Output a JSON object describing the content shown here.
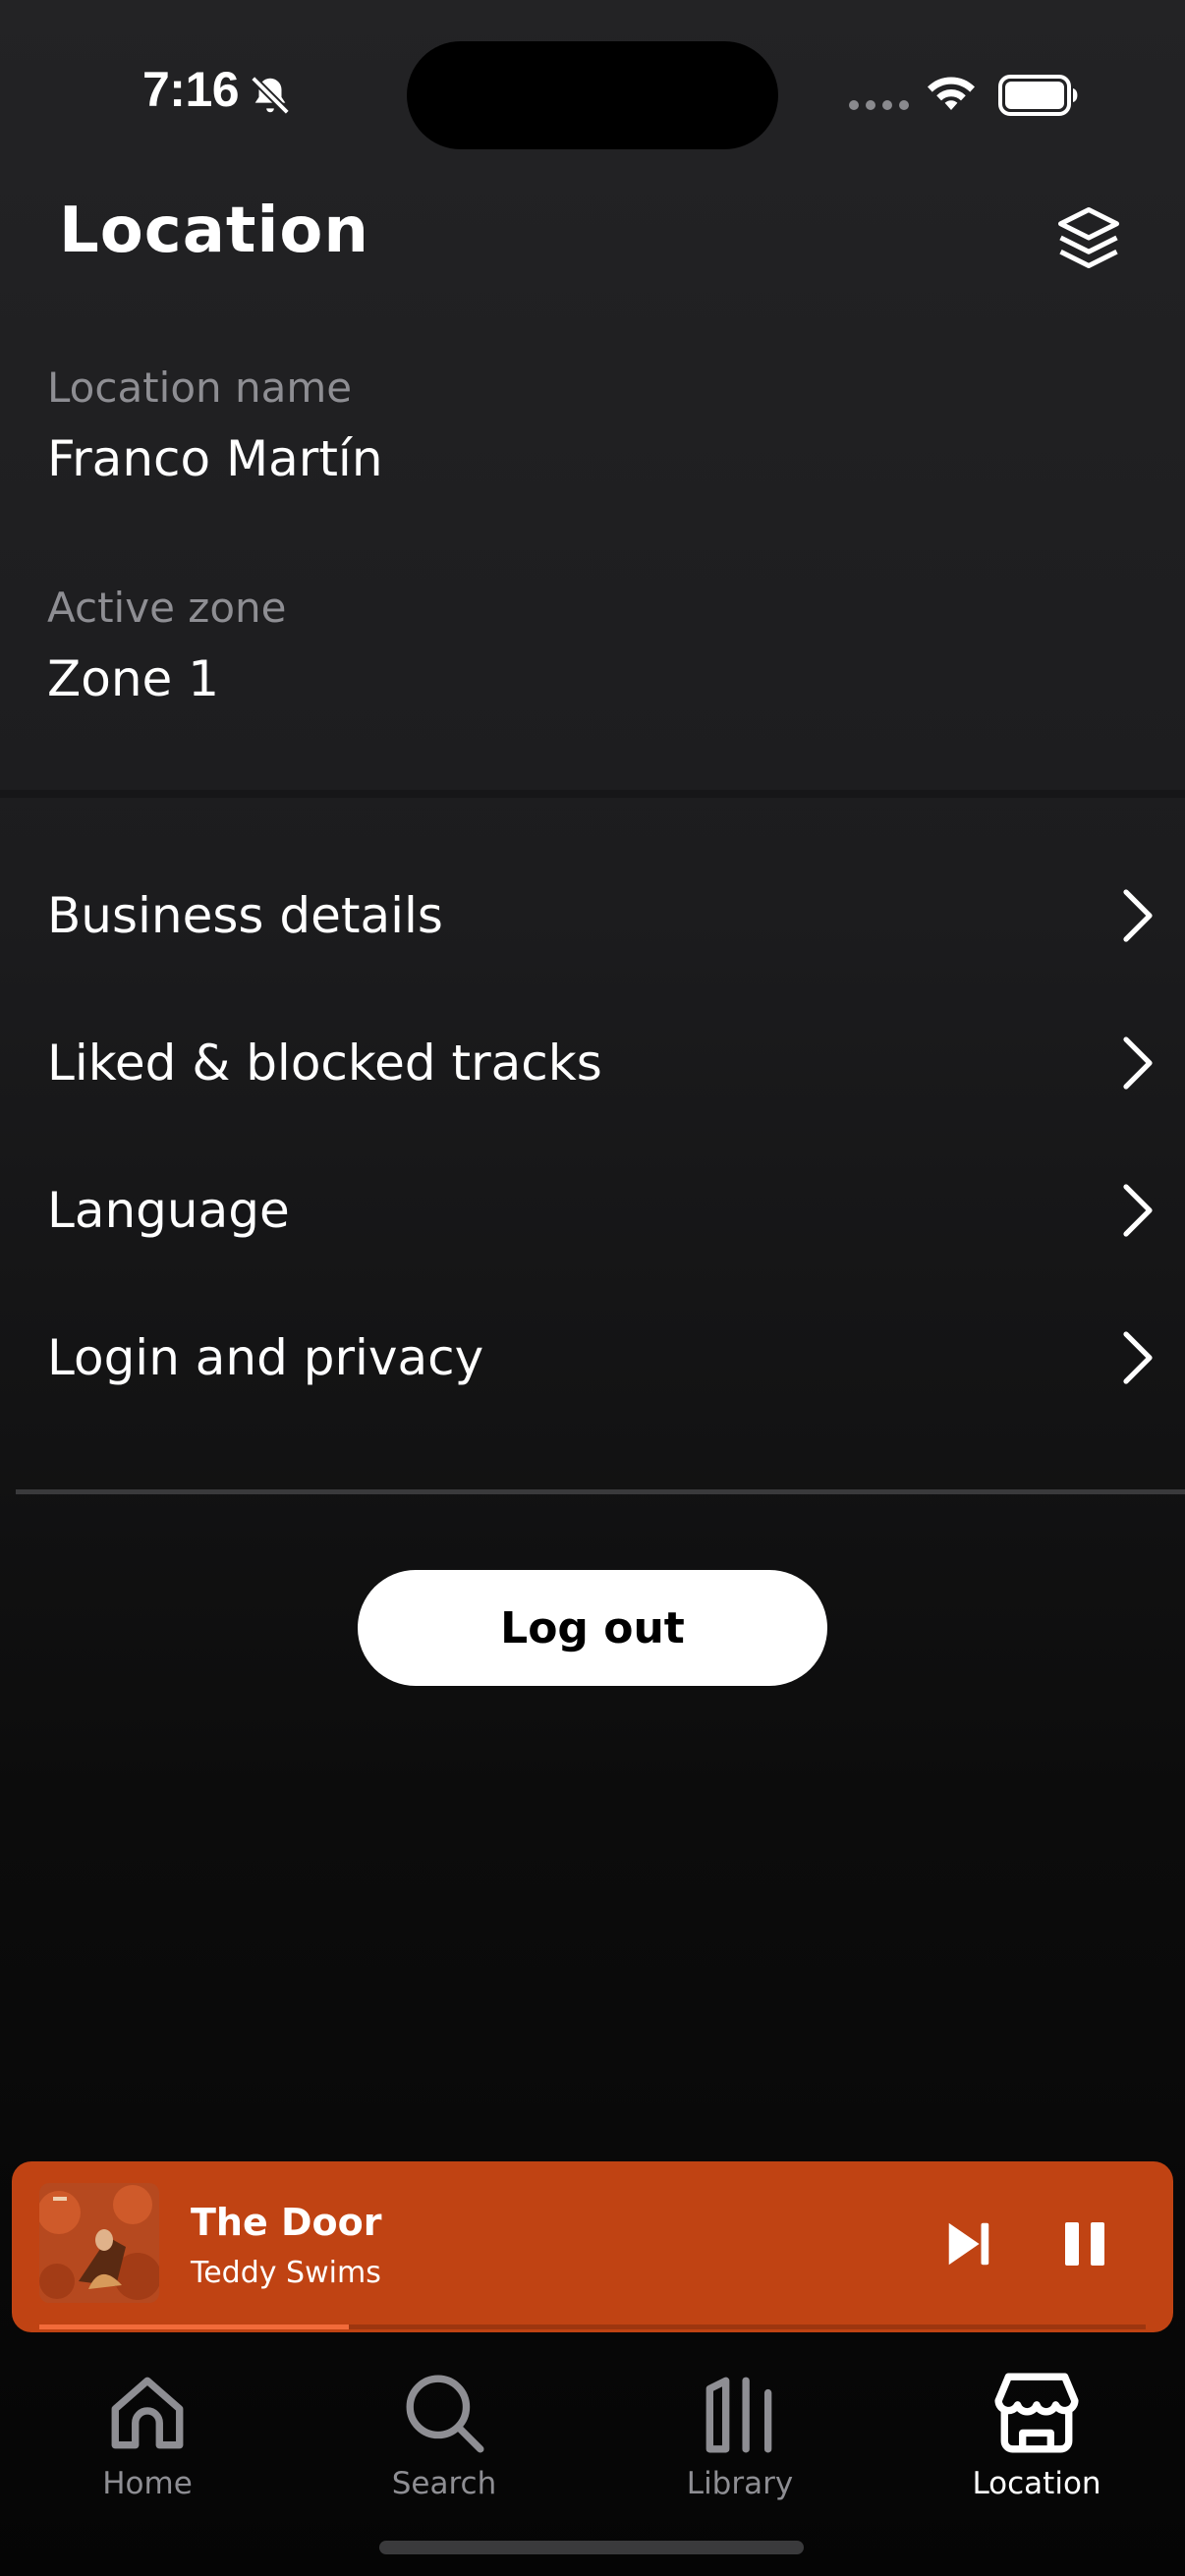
{
  "status_bar": {
    "time": "7:16"
  },
  "header": {
    "title": "Location",
    "layers_icon": "layers-icon"
  },
  "info": {
    "location_name_label": "Location name",
    "location_name_value": "Franco Martín",
    "active_zone_label": "Active zone",
    "active_zone_value": "Zone 1"
  },
  "menu": {
    "items": [
      {
        "label": "Business details"
      },
      {
        "label": "Liked & blocked tracks"
      },
      {
        "label": "Language"
      },
      {
        "label": "Login and privacy"
      }
    ]
  },
  "actions": {
    "logout_label": "Log out"
  },
  "now_playing": {
    "title": "The Door",
    "artist": "Teddy Swims",
    "progress_fraction": 0.28,
    "accent_color": "#c04313"
  },
  "tabs": [
    {
      "label": "Home",
      "icon": "home-icon"
    },
    {
      "label": "Search",
      "icon": "search-icon"
    },
    {
      "label": "Library",
      "icon": "library-icon"
    },
    {
      "label": "Location",
      "icon": "store-icon",
      "active": true
    }
  ]
}
